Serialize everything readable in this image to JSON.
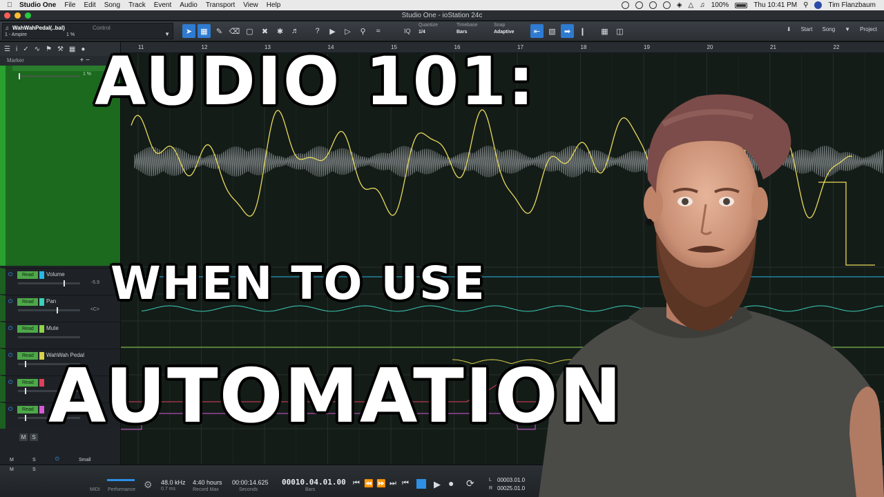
{
  "menubar": {
    "app": "Studio One",
    "items": [
      "File",
      "Edit",
      "Song",
      "Track",
      "Event",
      "Audio",
      "Transport",
      "View",
      "Help"
    ],
    "battery": "100%",
    "clock": "Thu 10:41 PM",
    "user": "Tim Flanzbaum"
  },
  "window": {
    "title": "Studio One - ioStation 24c"
  },
  "toolbar": {
    "track_name": "WahWahPedal(..bal)",
    "control_label": "Control",
    "device": "1 - Ampire",
    "device_value": "1 %",
    "quantize_label": "Quantize",
    "quantize_value": "1/4",
    "timebase_label": "Timebase",
    "timebase_value": "Bars",
    "snap_label": "Snap",
    "snap_value": "Adaptive",
    "iq_label": "IQ",
    "start": "Start",
    "song": "Song",
    "project": "Project"
  },
  "inspector": {
    "marker_label": "Marker",
    "lane_value": "1 %",
    "lanes": [
      {
        "mode": "Read",
        "name": "Volume",
        "readout": "-5.9",
        "color": "#29b6e8"
      },
      {
        "mode": "Read",
        "name": "Pan",
        "readout": "<C>",
        "color": "#3bd1b8"
      },
      {
        "mode": "Read",
        "name": "Mute",
        "readout": "",
        "color": "#8fd14a"
      },
      {
        "mode": "Read",
        "name": "WahWah Pedal",
        "readout": "",
        "color": "#d8d24a"
      },
      {
        "mode": "Read",
        "name": "",
        "readout": "",
        "color": "#e0405a"
      },
      {
        "mode": "Read",
        "name": "",
        "readout": "",
        "color": "#d65ad6"
      }
    ],
    "bottom_m": "M",
    "bottom_s": "S",
    "bottom_size": "Small"
  },
  "ruler": {
    "bars": [
      "11",
      "12",
      "13",
      "14",
      "15",
      "16",
      "17",
      "18",
      "19",
      "20",
      "21",
      "22"
    ]
  },
  "transport": {
    "midi_label": "MIDI",
    "performance_label": "Performance",
    "sample_rate": "48.0 kHz",
    "latency": "0.7 ms",
    "record_time": "4:40 hours",
    "record_max_label": "Record Max",
    "seconds_value": "00:00:14.625",
    "seconds_label": "Seconds",
    "bars_value": "00010.04.01.00",
    "bars_label": "Bars",
    "loop_l_label": "L",
    "loop_l": "00003.01.0",
    "loop_r_label": "R",
    "loop_r": "00025.01.0"
  },
  "headline": {
    "line1": "AUDIO 101:",
    "line2": "WHEN TO USE",
    "line3": "AUTOMATION"
  },
  "colors": {
    "automation_yellow": "#e9dc5a",
    "waveform": "#9aa0a3",
    "arrangement_bg": "#141c18",
    "track_green": "#1b6a1e"
  }
}
